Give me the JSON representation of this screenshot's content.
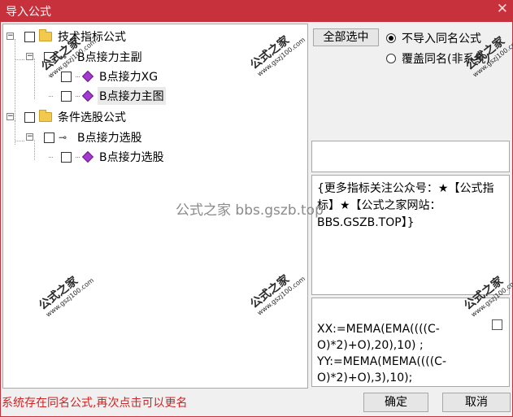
{
  "window": {
    "title": "导入公式",
    "close_glyph": "✕"
  },
  "tree": {
    "nodes": [
      {
        "label": "技术指标公式",
        "type": "folder",
        "expander": "−"
      },
      {
        "label": "B点接力主副",
        "type": "group",
        "expander": "−"
      },
      {
        "label": "B点接力XG",
        "type": "formula"
      },
      {
        "label": "B点接力主图",
        "type": "formula",
        "selected": true
      },
      {
        "label": "条件选股公式",
        "type": "folder",
        "expander": "−"
      },
      {
        "label": "B点接力选股",
        "type": "group",
        "expander": "−"
      },
      {
        "label": "B点接力选股",
        "type": "formula"
      }
    ]
  },
  "options": {
    "select_all_label": "全部选中",
    "radio_no_import": "不导入同名公式",
    "radio_overwrite": "覆盖同名(非系统)",
    "selected": "radio_no_import"
  },
  "info_text": "{更多指标关注公众号：★【公式指标】★【公式之家网站：BBS.GSZB.TOP】}",
  "formula_text": "XX:=MEMA(EMA((((C-O)*2)+O),20),10) ;\nYY:=MEMA(MEMA((((C-O)*2)+O),3),10);",
  "status_text": "系统存在同名公式,再次点击可以更名",
  "buttons": {
    "ok": "确定",
    "cancel": "取消"
  },
  "watermark": {
    "center_text": "公式之家 bbs.gszb.top",
    "stamp_title": "公式之家",
    "stamp_url": "www.gszj100.com"
  },
  "colors": {
    "titlebar": "#c7313c",
    "status": "#d42222",
    "formula_icon": "#a33bd1"
  }
}
